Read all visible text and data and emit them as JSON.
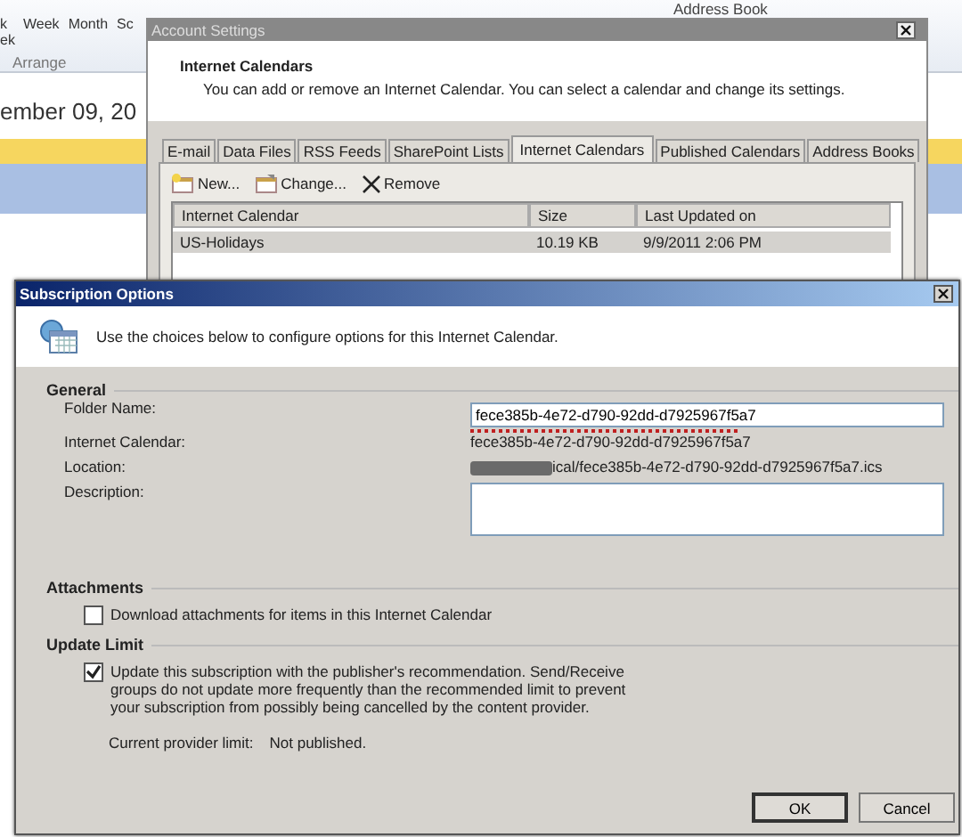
{
  "background": {
    "ribbon_items": [
      "k ek",
      "Week",
      "Month",
      "Sc"
    ],
    "ribbon_group": "Arrange",
    "address_book": "Address Book",
    "date_heading": "ember 09, 20"
  },
  "account_settings": {
    "title": "Account Settings",
    "heading": "Internet Calendars",
    "description": "You can add or remove an Internet Calendar. You can select a calendar and change its settings.",
    "tabs": [
      {
        "label": "E-mail",
        "selected": false
      },
      {
        "label": "Data Files",
        "selected": false
      },
      {
        "label": "RSS Feeds",
        "selected": false
      },
      {
        "label": "SharePoint Lists",
        "selected": false
      },
      {
        "label": "Internet Calendars",
        "selected": true
      },
      {
        "label": "Published Calendars",
        "selected": false
      },
      {
        "label": "Address Books",
        "selected": false
      }
    ],
    "toolbar": [
      {
        "kind": "new",
        "label": "New..."
      },
      {
        "kind": "change",
        "label": "Change..."
      },
      {
        "kind": "remove",
        "label": "Remove"
      }
    ],
    "columns": [
      "Internet Calendar",
      "Size",
      "Last Updated on"
    ],
    "rows": [
      {
        "cells": [
          "US-Holidays",
          "10.19 KB",
          "9/9/2011 2:06 PM"
        ],
        "selected": true
      }
    ]
  },
  "subscription_options": {
    "title": "Subscription Options",
    "intro": "Use the choices below to configure options for this Internet Calendar.",
    "general": {
      "heading": "General",
      "folder_name_label": "Folder Name:",
      "folder_name": "fece385b-4e72-d790-92dd-d7925967f5a7",
      "internet_calendar_label": "Internet Calendar:",
      "internet_calendar": "fece385b-4e72-d790-92dd-d7925967f5a7",
      "location_label": "Location:",
      "location": "ical/fece385b-4e72-d790-92dd-d7925967f5a7.ics",
      "description_label": "Description:"
    },
    "attachments": {
      "heading": "Attachments",
      "label": "Download attachments for items in this Internet Calendar",
      "checked": false
    },
    "update_limit": {
      "heading": "Update Limit",
      "label": "Update this subscription with the publisher's recommendation. Send/Receive groups do not update more frequently than the recommended limit to prevent your subscription from possibly being cancelled by the content provider.",
      "checked": true,
      "provider_limit_label": "Current provider limit:",
      "provider_limit": "Not published."
    },
    "buttons": [
      "OK",
      "Cancel"
    ]
  }
}
